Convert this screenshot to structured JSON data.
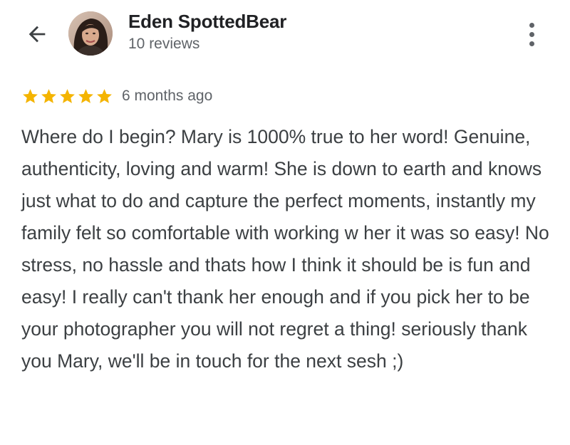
{
  "header": {
    "back_icon": "arrow-left-icon",
    "reviewer_name": "Eden SpottedBear",
    "review_count": "10 reviews",
    "more_icon": "more-vert-icon"
  },
  "review": {
    "rating": 5,
    "rating_max": 5,
    "star_color": "#f4b400",
    "date": "6 months ago",
    "text": "Where do I begin? Mary is 1000% true to her word! Genuine, authenticity, loving and warm! She is down to earth and knows just what to do and capture the perfect moments, instantly my family felt so comfortable with working w her it was so easy! No stress, no hassle and thats how I think it should be is fun and easy! I really can't thank her enough and if you pick her to be your photographer you will not regret a thing! seriously thank you Mary, we'll be in touch for the next sesh ;)"
  }
}
